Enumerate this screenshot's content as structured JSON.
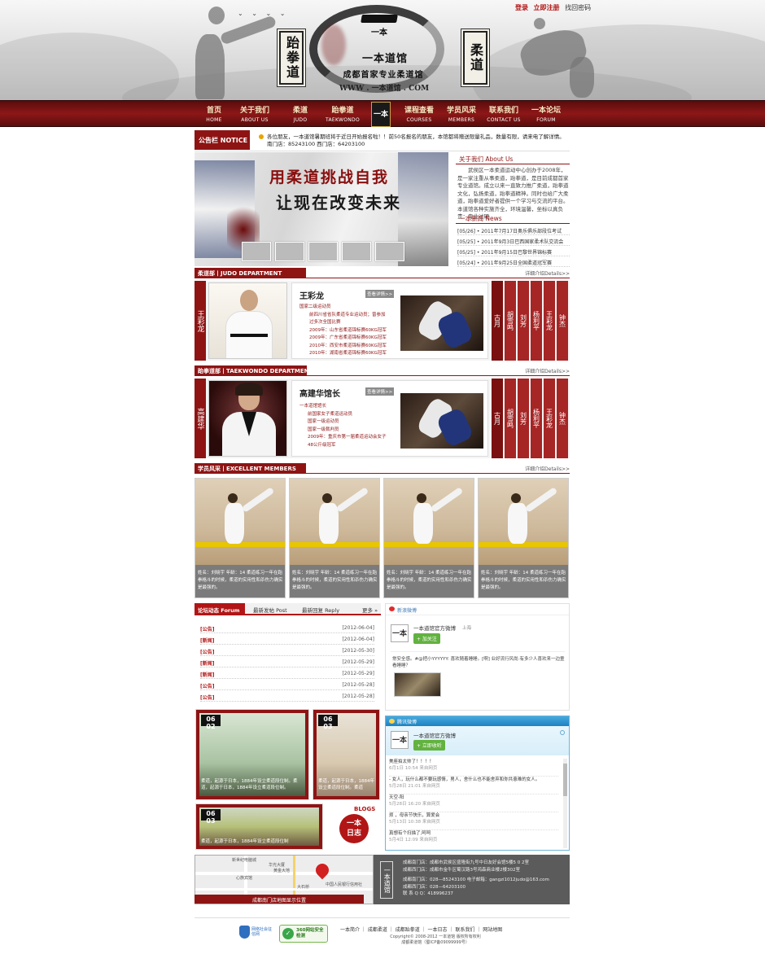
{
  "header": {
    "banner_left": "跆拳道",
    "banner_right": "柔道",
    "logo_mark": "一本",
    "club_name": "一本道馆",
    "slogan": "成都首家专业柔道馆",
    "website": "WWW . 一本道馆 . COM",
    "top_links": [
      "登录",
      "立即注册",
      "找回密码"
    ]
  },
  "nav": {
    "items": [
      {
        "zh": "首页",
        "en": "HOME"
      },
      {
        "zh": "关于我们",
        "en": "ABOUT US"
      },
      {
        "zh": "柔道",
        "en": "JUDO"
      },
      {
        "zh": "跆拳道",
        "en": "TAEKWONDO"
      },
      {
        "zh": "课程查看",
        "en": "COURSES"
      },
      {
        "zh": "学员风采",
        "en": "MEMBERS"
      },
      {
        "zh": "联系我们",
        "en": "CONTACT US"
      },
      {
        "zh": "一本论坛",
        "en": "FORUM"
      }
    ],
    "logo": "一本"
  },
  "notice": {
    "tag": "公告栏 NOTICE",
    "line1": "各位朋友，一本道馆暑期班将于近日开始报名啦！！前50名报名的朋友，本馆都将赠送限量礼品，数量有限，请来电了解详情。",
    "line2": "南门店：85243100   西门店：64203100"
  },
  "banner": {
    "line1": "用柔道挑战自我",
    "line2": "让现在改变未来"
  },
  "about": {
    "heading": "关于我们 About Us",
    "text": "武侯区一本柔道运动中心创办于2008年，是一家注重从事柔道，跆拳道，是目前成都首家专业道馆。成立以来一直致力推广柔道，跆拳道文化，弘扬柔道，跆拳道精神。同时也给广大柔道，跆拳道爱好者提供一个学习与交流的平台。本道馆各种实施齐全，环境温馨，坐标以真负责：专业过硬"
  },
  "news": {
    "heading": "一本新闻 News",
    "items": [
      "[05/26] • 2011年7月17日奥乐俱乐部段位考试",
      "[05/25] • 2011年9月3日巴西国家柔术队交流会",
      "[05/25] • 2011年9月15日巴黎世界锦标赛",
      "[05/24] • 2011年9月25日全国柔道冠军赛"
    ]
  },
  "judo_dept": {
    "tag": "柔道部丨JUDO DEPARTMENT",
    "more": "详细介绍Details>>",
    "coach_vertical": "王彩龙",
    "coach": "王彩龙",
    "view_more": "查看详情>>",
    "lines": [
      "国家二级运动员",
      "前四川省省队柔道专业运动员；曾参加",
      "过多次全国比赛",
      "2009年：山东省柔道锦标赛60KG冠军",
      "2009年：广东省柔道锦标赛60KG冠军",
      "2010年：西安市柔道锦标赛60KG冠军",
      "2010年：湖南省柔道锦标赛60KG冠军"
    ],
    "tabs": [
      "古月",
      "胡雪鸣",
      "刘芳",
      "杨利平",
      "王彩龙",
      "钟杰"
    ]
  },
  "tkd_dept": {
    "tag": "跆拳道部丨TAEKWONDO DEPARTMENT",
    "more": "详细介绍Details>>",
    "coach_vertical": "高建华",
    "coach": "高建华馆长",
    "view_more": "查看详情>>",
    "lines": [
      "一本道馆馆长",
      "前国家女子柔道运动员",
      "国家一级运动员",
      "国家一级裁判员",
      "2009年：重庆市第一届柔道运动会女子",
      "48公斤级冠军"
    ],
    "tabs": [
      "古月",
      "胡雪鸣",
      "刘芳",
      "杨利平",
      "王彩龙",
      "钟杰"
    ]
  },
  "members": {
    "tag": "学员风采丨EXCELLENT MEMBERS",
    "more": "详细介绍Details>>",
    "items": [
      {
        "name": "刘晓宇",
        "age": "14",
        "text": "姓名：刘晓宇 年龄：14 柔道练习一年在跆拳格斗的时候，柔道的实用性和杀伤力确实是最强的。"
      },
      {
        "name": "刘晓宇",
        "age": "14",
        "text": "姓名：刘晓宇 年龄：14 柔道练习一年在跆拳格斗的时候，柔道的实用性和杀伤力确实是最强的。"
      },
      {
        "name": "刘晓宇",
        "age": "14",
        "text": "姓名：刘晓宇 年龄：14 柔道练习一年在跆拳格斗的时候，柔道的实用性和杀伤力确实是最强的。"
      },
      {
        "name": "刘晓宇",
        "age": "14",
        "text": "姓名：刘晓宇 年龄：14 柔道练习一年在跆拳格斗的时候，柔道的实用性和杀伤力确实是最强的。"
      }
    ]
  },
  "forum": {
    "tabs": [
      "论坛动态 Forum",
      "最新发帖 Post",
      "最新回复 Reply"
    ],
    "more": "更多 »",
    "rows": [
      {
        "k": "[公告]",
        "d": "[2012-06-04]"
      },
      {
        "k": "[新闻]",
        "d": "[2012-06-04]"
      },
      {
        "k": "[公告]",
        "d": "[2012-05-30]"
      },
      {
        "k": "[新闻]",
        "d": "[2012-05-29]"
      },
      {
        "k": "[新闻]",
        "d": "[2012-05-29]"
      },
      {
        "k": "[公告]",
        "d": "[2012-05-28]"
      },
      {
        "k": "[公告]",
        "d": "[2012-05-28]"
      }
    ]
  },
  "weibo": {
    "title": "新浪微博",
    "account": "一本道馆官方微博",
    "location": "上海",
    "follow": "+ 加关注",
    "post": "常安全感。#@把小YYYYYY: 喜欢随着睡睡。[啊] 业好流行风尚:有多少人喜欢来一边童看睡睡？",
    "logo": "一本"
  },
  "tencent": {
    "title": "腾讯微博",
    "account": "一本道馆官方微博",
    "listen": "+ 立即收听",
    "logo": "一本",
    "posts": [
      {
        "text": "美座拍太帅了！！！！",
        "meta": "6月1日 10:54  来自网页"
      },
      {
        "text": "- 女人，玩什么都不要玩感情，男人，舍什么也不能舍弃和你共患难的女人。",
        "meta": "5月28日 21:01  来自网页"
      },
      {
        "text": "天空-阳",
        "meta": "5月28日 16:20  来自网页"
      },
      {
        "text": "烦 ，母亲节快乐，算爱会",
        "meta": "5月13日 10:38  来自网页"
      },
      {
        "text": "真想有个扫描了,呵呵",
        "meta": "5月4日 12:09  来自网页"
      }
    ]
  },
  "photos": [
    {
      "date": "06 02",
      "caption": "柔道，起源于日本，1884年设立柔道段位制。柔道，起源于日本，1884年设立柔道段位制。"
    },
    {
      "date": "06 03",
      "caption": "柔道，起源于日本，1884年设立柔道段位制。柔道"
    },
    {
      "date": "06 03",
      "caption": "柔道，起源于日本，1884年设立柔道段位制"
    }
  ],
  "blogs": {
    "en": "BLOGS",
    "zh": "一本日志"
  },
  "map": {
    "bar": "成都南门店地图显示位置",
    "labels": [
      "华光大厦",
      "黄金大地",
      "大石桥",
      "中国人民银行信用社",
      "新世纪电脑城",
      "心族宾馆"
    ]
  },
  "contact": {
    "logo": "一本道馆",
    "lines": [
      "成都南门店：成都市武侯区盛隆街九号中日友好会馆5楼5 0 2室",
      "成都西门店：成都市金牛区蜀汉路3号鸿森商业楼2楼302室",
      "成都南门店：028—85243100      电子邮箱：gangzi1012judo@163.com",
      "成都西门店：028—64203100",
      "联 系 Q  Q：418996237"
    ]
  },
  "footer": {
    "nav": [
      "一本简介",
      "成都柔道",
      "成都跆拳道",
      "一本日志",
      "联系我们",
      "网站地图"
    ],
    "copy1": "Copyright© 2008-2012 一本道馆 版权所有权利",
    "copy2": "成都柔道馆（蜀ICP备09099999号）",
    "badge1": "网络社会征信网",
    "badge2": "360网站安全检测"
  },
  "colors": {
    "brand": "#8e1414",
    "accent": "#b21515"
  }
}
